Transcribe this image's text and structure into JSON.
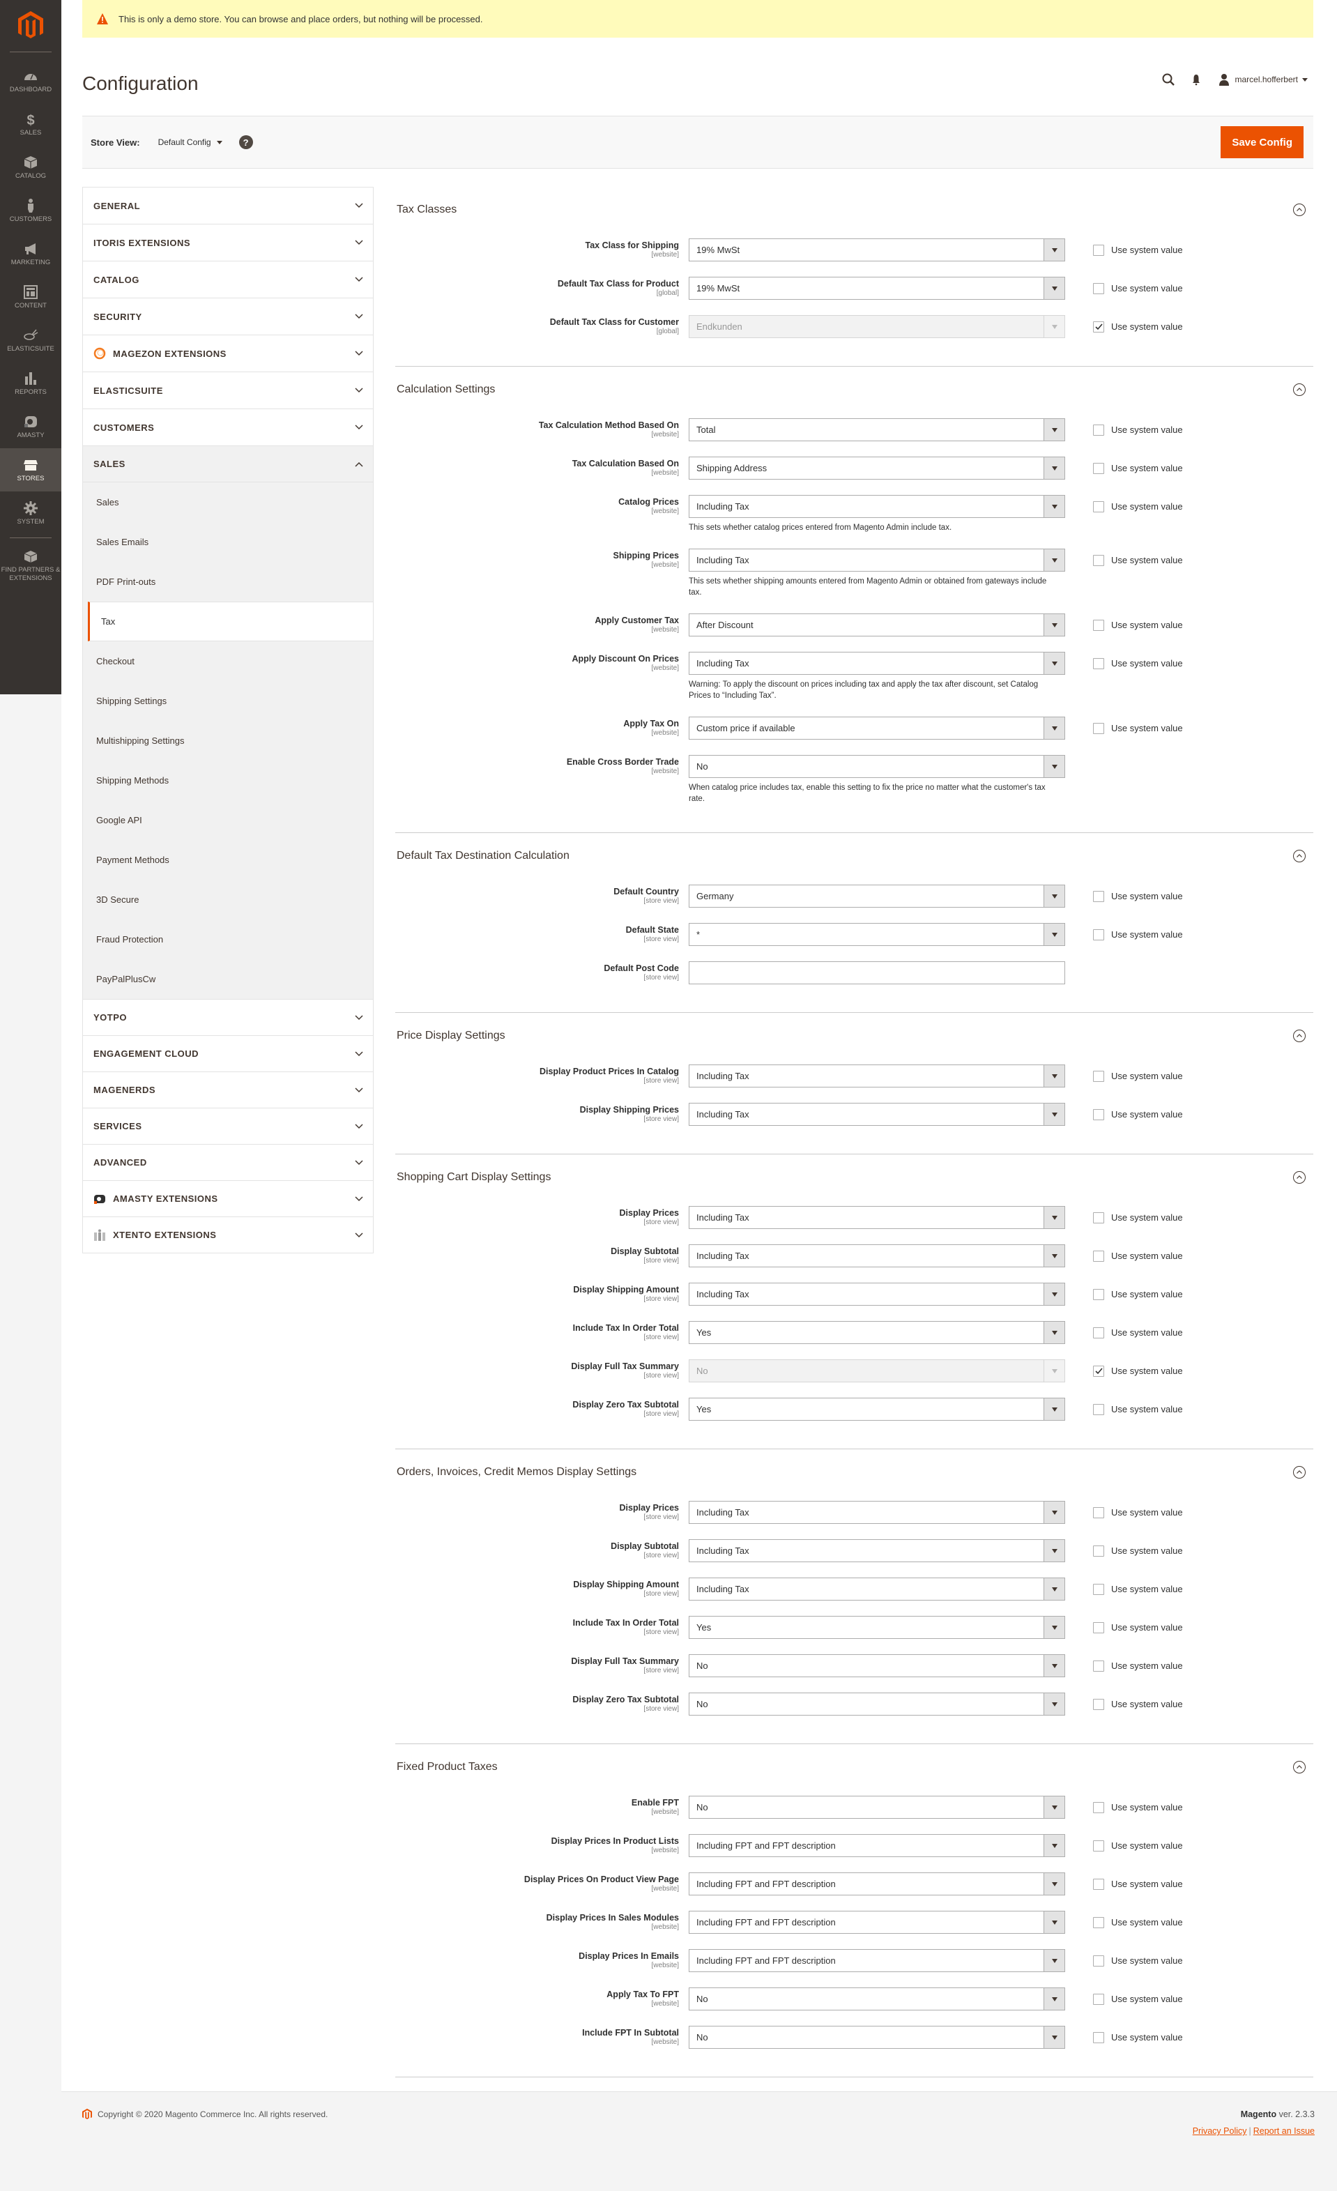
{
  "admin_nav": {
    "items": [
      {
        "label": "Dashboard",
        "icon": "dashboard-icon"
      },
      {
        "label": "Sales",
        "icon": "dollar-icon"
      },
      {
        "label": "Catalog",
        "icon": "box-icon"
      },
      {
        "label": "Customers",
        "icon": "person-icon"
      },
      {
        "label": "Marketing",
        "icon": "megaphone-icon"
      },
      {
        "label": "Content",
        "icon": "layout-icon"
      },
      {
        "label": "Elasticsuite",
        "icon": "rabbit-icon"
      },
      {
        "label": "Reports",
        "icon": "bar-chart-icon"
      },
      {
        "label": "Amasty",
        "icon": "amasty-icon"
      },
      {
        "label": "Stores",
        "icon": "store-icon",
        "active": true
      },
      {
        "label": "System",
        "icon": "gear-icon"
      },
      {
        "label": "Find Partners & Extensions",
        "icon": "lego-icon"
      }
    ]
  },
  "notice": {
    "text": "This is only a demo store. You can browse and place orders, but nothing will be processed."
  },
  "header": {
    "title": "Configuration",
    "username": "marcel.hofferbert"
  },
  "toolbar": {
    "store_view_label": "Store View:",
    "store_view_value": "Default Config",
    "help": "?",
    "save_label": "Save Config"
  },
  "tabs": {
    "groups_before": [
      "GENERAL",
      "ITORIS EXTENSIONS",
      "CATALOG",
      "SECURITY",
      "MAGEZON EXTENSIONS",
      "ELASTICSUITE",
      "CUSTOMERS"
    ],
    "open_group": "SALES",
    "sales_items": [
      "Sales",
      "Sales Emails",
      "PDF Print-outs",
      "Tax",
      "Checkout",
      "Shipping Settings",
      "Multishipping Settings",
      "Shipping Methods",
      "Google API",
      "Payment Methods",
      "3D Secure",
      "Fraud Protection",
      "PayPalPlusCw"
    ],
    "active_item": "Tax",
    "groups_after": [
      "YOTPO",
      "ENGAGEMENT CLOUD",
      "MAGENERDS",
      "SERVICES",
      "ADVANCED",
      "AMASTY EXTENSIONS",
      "XTENTO EXTENSIONS"
    ]
  },
  "use_system_value_label": "Use system value",
  "sections": [
    {
      "title": "Tax Classes",
      "rows": [
        {
          "label": "Tax Class for Shipping",
          "scope": "[website]",
          "value": "19% MwSt",
          "use_system": false
        },
        {
          "label": "Default Tax Class for Product",
          "scope": "[global]",
          "value": "19% MwSt",
          "use_system": false
        },
        {
          "label": "Default Tax Class for Customer",
          "scope": "[global]",
          "value": "Endkunden",
          "use_system": true,
          "disabled": true
        }
      ]
    },
    {
      "title": "Calculation Settings",
      "rows": [
        {
          "label": "Tax Calculation Method Based On",
          "scope": "[website]",
          "value": "Total",
          "use_system": false
        },
        {
          "label": "Tax Calculation Based On",
          "scope": "[website]",
          "value": "Shipping Address",
          "use_system": false
        },
        {
          "label": "Catalog Prices",
          "scope": "[website]",
          "value": "Including Tax",
          "use_system": false,
          "note": "This sets whether catalog prices entered from Magento Admin include tax."
        },
        {
          "label": "Shipping Prices",
          "scope": "[website]",
          "value": "Including Tax",
          "use_system": false,
          "note": "This sets whether shipping amounts entered from Magento Admin or obtained from gateways include tax."
        },
        {
          "label": "Apply Customer Tax",
          "scope": "[website]",
          "value": "After Discount",
          "use_system": false
        },
        {
          "label": "Apply Discount On Prices",
          "scope": "[website]",
          "value": "Including Tax",
          "use_system": false,
          "note": "Warning: To apply the discount on prices including tax and apply the tax after discount, set Catalog Prices to “Including Tax”."
        },
        {
          "label": "Apply Tax On",
          "scope": "[website]",
          "value": "Custom price if available",
          "use_system": false
        },
        {
          "label": "Enable Cross Border Trade",
          "scope": "[website]",
          "value": "No",
          "no_system": true,
          "note": "When catalog price includes tax, enable this setting to fix the price no matter what the customer's tax rate."
        }
      ]
    },
    {
      "title": "Default Tax Destination Calculation",
      "rows": [
        {
          "label": "Default Country",
          "scope": "[store view]",
          "value": "Germany",
          "use_system": false
        },
        {
          "label": "Default State",
          "scope": "[store view]",
          "value": "*",
          "use_system": false
        },
        {
          "label": "Default Post Code",
          "scope": "[store view]",
          "value": "",
          "type": "text",
          "no_system": true
        }
      ]
    },
    {
      "title": "Price Display Settings",
      "rows": [
        {
          "label": "Display Product Prices In Catalog",
          "scope": "[store view]",
          "value": "Including Tax",
          "use_system": false
        },
        {
          "label": "Display Shipping Prices",
          "scope": "[store view]",
          "value": "Including Tax",
          "use_system": false
        }
      ]
    },
    {
      "title": "Shopping Cart Display Settings",
      "rows": [
        {
          "label": "Display Prices",
          "scope": "[store view]",
          "value": "Including Tax",
          "use_system": false
        },
        {
          "label": "Display Subtotal",
          "scope": "[store view]",
          "value": "Including Tax",
          "use_system": false
        },
        {
          "label": "Display Shipping Amount",
          "scope": "[store view]",
          "value": "Including Tax",
          "use_system": false
        },
        {
          "label": "Include Tax In Order Total",
          "scope": "[store view]",
          "value": "Yes",
          "use_system": false
        },
        {
          "label": "Display Full Tax Summary",
          "scope": "[store view]",
          "value": "No",
          "use_system": true,
          "disabled": true
        },
        {
          "label": "Display Zero Tax Subtotal",
          "scope": "[store view]",
          "value": "Yes",
          "use_system": false
        }
      ]
    },
    {
      "title": "Orders, Invoices, Credit Memos Display Settings",
      "rows": [
        {
          "label": "Display Prices",
          "scope": "[store view]",
          "value": "Including Tax",
          "use_system": false
        },
        {
          "label": "Display Subtotal",
          "scope": "[store view]",
          "value": "Including Tax",
          "use_system": false
        },
        {
          "label": "Display Shipping Amount",
          "scope": "[store view]",
          "value": "Including Tax",
          "use_system": false
        },
        {
          "label": "Include Tax In Order Total",
          "scope": "[store view]",
          "value": "Yes",
          "use_system": false
        },
        {
          "label": "Display Full Tax Summary",
          "scope": "[store view]",
          "value": "No",
          "use_system": false
        },
        {
          "label": "Display Zero Tax Subtotal",
          "scope": "[store view]",
          "value": "No",
          "use_system": false
        }
      ]
    },
    {
      "title": "Fixed Product Taxes",
      "rows": [
        {
          "label": "Enable FPT",
          "scope": "[website]",
          "value": "No",
          "use_system": false
        },
        {
          "label": "Display Prices In Product Lists",
          "scope": "[website]",
          "value": "Including FPT and FPT description",
          "use_system": false
        },
        {
          "label": "Display Prices On Product View Page",
          "scope": "[website]",
          "value": "Including FPT and FPT description",
          "use_system": false
        },
        {
          "label": "Display Prices In Sales Modules",
          "scope": "[website]",
          "value": "Including FPT and FPT description",
          "use_system": false
        },
        {
          "label": "Display Prices In Emails",
          "scope": "[website]",
          "value": "Including FPT and FPT description",
          "use_system": false
        },
        {
          "label": "Apply Tax To FPT",
          "scope": "[website]",
          "value": "No",
          "use_system": false
        },
        {
          "label": "Include FPT In Subtotal",
          "scope": "[website]",
          "value": "No",
          "use_system": false
        }
      ]
    }
  ],
  "footer": {
    "copyright": "Copyright © 2020 Magento Commerce Inc. All rights reserved.",
    "brand": "Magento",
    "version": "ver. 2.3.3",
    "privacy_policy": "Privacy Policy",
    "separator": "|",
    "report_issue": "Report an Issue"
  },
  "colors": {
    "accent": "#eb5202",
    "nav_bg": "#373330",
    "notice_bg": "#fffbbb"
  }
}
